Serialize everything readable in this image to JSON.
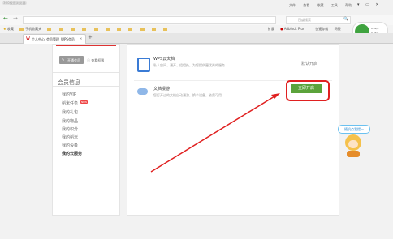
{
  "window": {
    "title": "360极速浏览器",
    "menu": [
      "文件",
      "查看",
      "收藏",
      "工具",
      "帮助"
    ],
    "controls": [
      "▾",
      "▭",
      "✕"
    ]
  },
  "toolbar": {
    "back_label": "←",
    "forward_label": "→",
    "search_placeholder": "百度搜索",
    "search_icon": "🔍"
  },
  "bookmarks": {
    "label": "收藏",
    "items": [
      "手机收藏夹",
      "",
      "",
      "",
      "",
      "",
      "",
      "",
      "",
      "",
      "",
      "",
      "",
      "",
      ""
    ],
    "ext": [
      "扩展",
      "Adblock Plus",
      "",
      "快速存储",
      "网银"
    ]
  },
  "weather": {
    "temp": "",
    "line1": "0.0K/s",
    "line2": "0.0K/s"
  },
  "tab": {
    "label": "个人中心_会员管理_WPS会员",
    "close": "✕",
    "new_tab": "+"
  },
  "sidebar": {
    "upgrade_btn": "开通会员",
    "rights_label": "查看权限",
    "section_title": "会员信息",
    "items": [
      "我的VIP",
      "稻米任务",
      "我的礼包",
      "我的物品",
      "我的积分",
      "我的稻米",
      "我的设备",
      "我的云服务"
    ],
    "badge": "NEW"
  },
  "service1": {
    "title": "WPS云文档",
    "desc": "私人空间、漫开、组相处，为您提供更优秀的服务",
    "action": "默认开启"
  },
  "service2": {
    "title": "文档漫游",
    "desc": "您打开过的文档自动漫游，换个设备，依然可用",
    "action": "立即开启"
  },
  "assistant": {
    "bubble": "随机点我提一"
  }
}
